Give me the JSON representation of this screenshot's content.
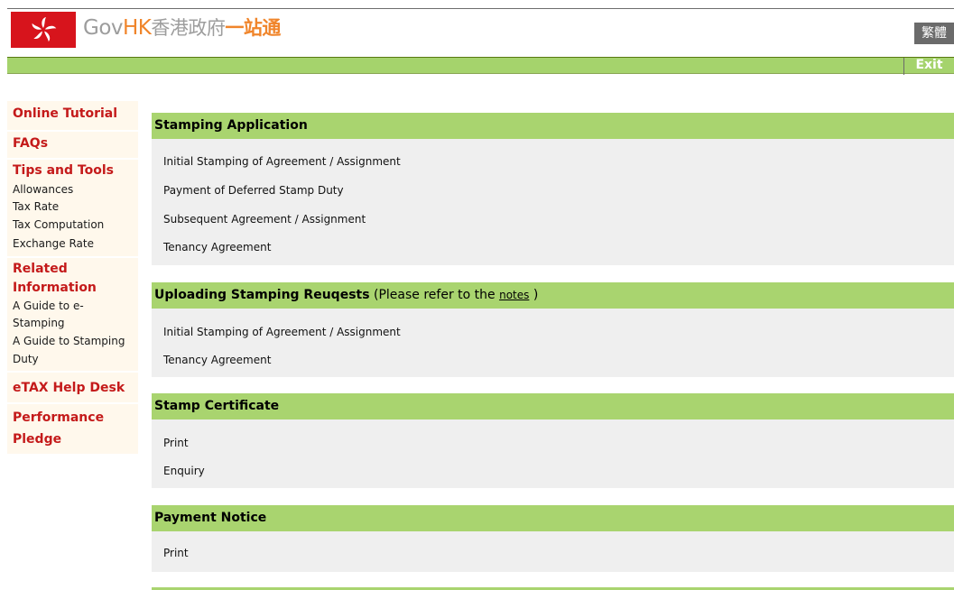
{
  "header": {
    "logo_gov": "Gov",
    "logo_hk": "HK",
    "logo_zh1": "香港政府",
    "logo_zh2": "一站通",
    "lang_button": "繁體",
    "exit_button": "Exit"
  },
  "sidebar": {
    "online_tutorial": "Online Tutorial",
    "faqs": "FAQs",
    "tips_and_tools": "Tips and Tools",
    "tips_items": [
      "Allowances",
      "Tax Rate",
      "Tax Computation",
      "Exchange Rate"
    ],
    "related_line1": "Related",
    "related_line2": "Information",
    "related_items": [
      "A Guide to e-",
      "Stamping",
      "A Guide to Stamping",
      "Duty"
    ],
    "etax_help_desk": "eTAX Help Desk",
    "performance_line1": "Performance",
    "performance_line2": "Pledge"
  },
  "sections": [
    {
      "title": "Stamping Application",
      "items": [
        "Initial Stamping of Agreement / Assignment",
        "Payment of Deferred Stamp Duty",
        "Subsequent Agreement / Assignment",
        "Tenancy Agreement"
      ]
    },
    {
      "title": "Uploading Stamping Reuqests",
      "note_prefix": " (Please refer to the ",
      "note_link": "notes",
      "note_suffix": " )",
      "items": [
        "Initial Stamping of Agreement / Assignment",
        "Tenancy Agreement"
      ]
    },
    {
      "title": "Stamp Certificate",
      "items": [
        "Print",
        "Enquiry"
      ]
    },
    {
      "title": "Payment Notice",
      "items": [
        "Print"
      ]
    }
  ],
  "colors": {
    "green": "#a9d46f",
    "sidebar_bg": "#fff8ec",
    "nav_red": "#c41a1a",
    "section_body": "#efefef",
    "logo_orange": "#f0852b"
  }
}
